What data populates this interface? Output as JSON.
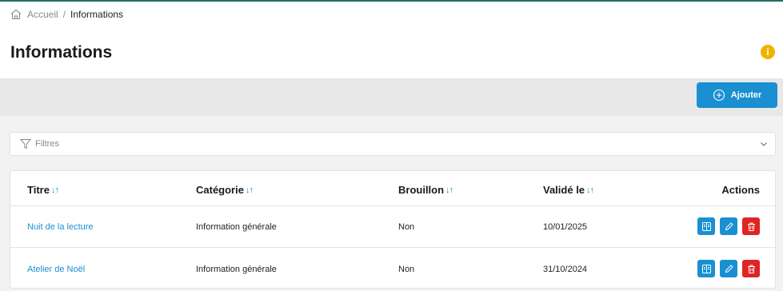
{
  "breadcrumb": {
    "home": "Accueil",
    "separator": "/",
    "current": "Informations"
  },
  "page": {
    "title": "Informations",
    "info_icon": "i"
  },
  "toolbar": {
    "add_label": "Ajouter"
  },
  "filters": {
    "label": "Filtres"
  },
  "table": {
    "columns": [
      "Titre",
      "Catégorie",
      "Brouillon",
      "Validé le",
      "Actions"
    ],
    "sort_glyph": "↓↑",
    "rows": [
      {
        "title": "Nuit de la lecture",
        "category": "Information générale",
        "draft": "Non",
        "validated": "10/01/2025"
      },
      {
        "title": "Atelier de Noël",
        "category": "Information générale",
        "draft": "Non",
        "validated": "31/10/2024"
      }
    ]
  },
  "colors": {
    "accent": "#1a8fd1",
    "danger": "#e02424",
    "warning": "#f0b400",
    "topline": "#1f6f64"
  },
  "icons": [
    "home-icon",
    "info-icon",
    "plus-circle-icon",
    "filter-icon",
    "chevron-down-icon",
    "view-icon",
    "edit-pencil-icon",
    "trash-icon"
  ]
}
